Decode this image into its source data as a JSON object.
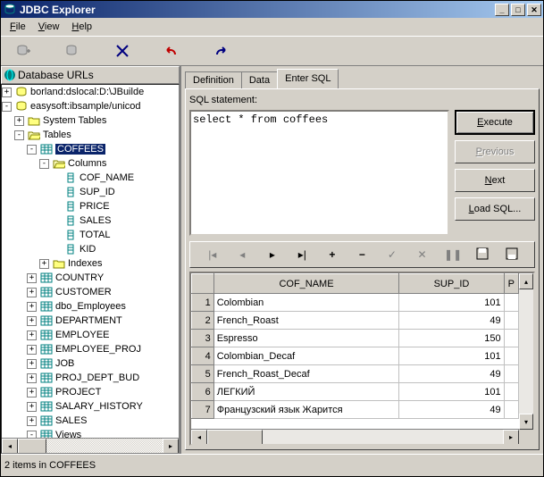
{
  "title": "JDBC Explorer",
  "menu": {
    "file": "File",
    "view": "View",
    "help": "Help"
  },
  "tree_header": "Database URLs",
  "tree": {
    "db1": "borland:dslocal:D:\\JBuilde",
    "db2": "easysoft:ibsample/unicod",
    "systables": "System Tables",
    "tables": "Tables",
    "coffees": "COFFEES",
    "columns": "Columns",
    "cols": [
      "COF_NAME",
      "SUP_ID",
      "PRICE",
      "SALES",
      "TOTAL",
      "KID"
    ],
    "indexes": "Indexes",
    "others": [
      "COUNTRY",
      "CUSTOMER",
      "dbo_Employees",
      "DEPARTMENT",
      "EMPLOYEE",
      "EMPLOYEE_PROJ",
      "JOB",
      "PROJ_DEPT_BUD",
      "PROJECT",
      "SALARY_HISTORY",
      "SALES",
      "Views"
    ]
  },
  "tabs": {
    "definition": "Definition",
    "data": "Data",
    "entersql": "Enter SQL"
  },
  "sql": {
    "label": "SQL statement:",
    "text": "select * from coffees",
    "execute": "Execute",
    "previous": "Previous",
    "next": "Next",
    "loadsql": "Load SQL..."
  },
  "grid": {
    "cols": [
      "COF_NAME",
      "SUP_ID",
      "P"
    ],
    "rows": [
      {
        "n": "1",
        "name": "Colombian",
        "sup": "101"
      },
      {
        "n": "2",
        "name": "French_Roast",
        "sup": "49"
      },
      {
        "n": "3",
        "name": "Espresso",
        "sup": "150"
      },
      {
        "n": "4",
        "name": "Colombian_Decaf",
        "sup": "101"
      },
      {
        "n": "5",
        "name": "French_Roast_Decaf",
        "sup": "49"
      },
      {
        "n": "6",
        "name": "ЛЕГКИЙ",
        "sup": "101"
      },
      {
        "n": "7",
        "name": "Французский язык Жарится",
        "sup": "49"
      }
    ]
  },
  "status": "2 items in COFFEES"
}
